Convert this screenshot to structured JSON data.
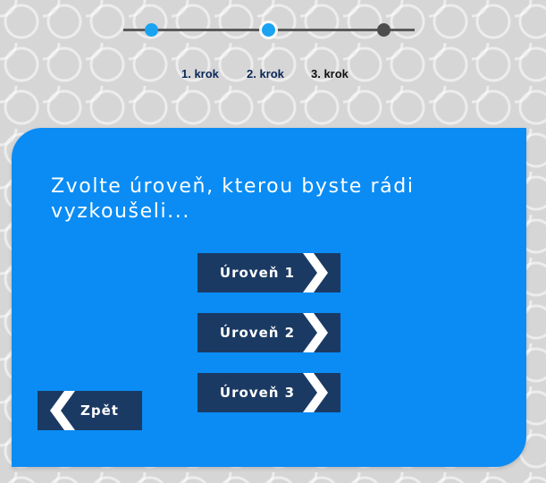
{
  "stepper": {
    "steps": [
      {
        "label": "1. krok",
        "state": "completed"
      },
      {
        "label": "2. krok",
        "state": "current"
      },
      {
        "label": "3. krok",
        "state": "upcoming"
      }
    ]
  },
  "panel": {
    "question": "Zvolte úroveň, kterou byste rádi vyzkoušeli...",
    "levels": [
      {
        "label": "Úroveň 1"
      },
      {
        "label": "Úroveň 2"
      },
      {
        "label": "Úroveň 3"
      }
    ],
    "back_label": "Zpět"
  },
  "colors": {
    "panel_blue": "#0a8cf4",
    "button_navy": "#1b3a63",
    "step_active": "#1aa3f1",
    "step_inactive": "#4d4d4d",
    "text_white": "#ffffff"
  },
  "icons": {
    "level_arrow": "chevron-right-icon",
    "back_arrow": "chevron-left-icon"
  }
}
